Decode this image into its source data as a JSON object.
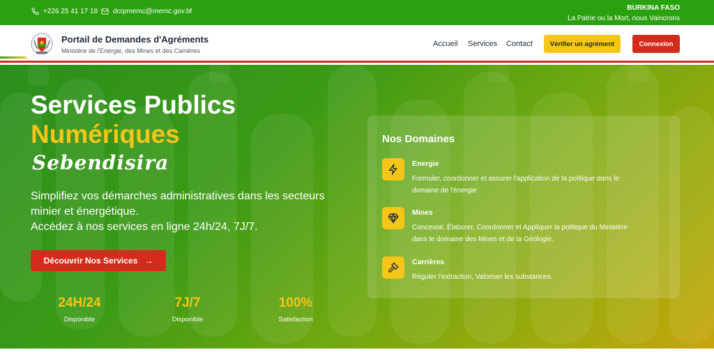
{
  "topbar": {
    "phone": "+226 25 41 17 18",
    "email": "dcrpmemc@memc.gov.bf",
    "country": "BURKINA FASO",
    "motto": "La Patrie ou la Mort, nous Vaincrons"
  },
  "header": {
    "title": "Portail de Demandes d'Agréments",
    "subtitle": "Ministère de l'Energie, des Mines et des Carrières",
    "nav": [
      "Accueil",
      "Services",
      "Contact"
    ],
    "verify_label": "Vérifier un agrément",
    "login_label": "Connexion"
  },
  "hero": {
    "title_line1": "Services Publics",
    "title_line2": "Numériques",
    "script_name": "Sebendisira",
    "desc_line1": "Simplifiez vos démarches administratives dans les secteurs",
    "desc_line2": "minier et énergétique.",
    "desc_line3": "Accédez à nos services en ligne 24h/24, 7J/7.",
    "cta_label": "Découvrir Nos Services",
    "stats": [
      {
        "value": "24H/24",
        "label": "Disponible"
      },
      {
        "value": "7J/7",
        "label": "Disponible"
      },
      {
        "value": "100%",
        "label": "Satisfaction"
      }
    ]
  },
  "domains": {
    "title": "Nos Domaines",
    "items": [
      {
        "title": "Energie",
        "desc_line1": "Formuler, coordonner et assurer l'application de la politique dans le",
        "desc_line2": "domaine de l'énergie",
        "icon": "lightning-icon"
      },
      {
        "title": "Mines",
        "desc_line1": "Concevoir, Élaborer, Coordonner et Appliquer la politique du Ministère",
        "desc_line2": "dans le domaine des Mines et de la Géologie.",
        "icon": "gem-icon"
      },
      {
        "title": "Carrières",
        "desc_line1": "Réguler l'extraction, Valoriser les substances.",
        "icon": "hammer-icon"
      }
    ]
  },
  "colors": {
    "green": "#2aa10f",
    "yellow": "#f5c518",
    "red": "#d42c1c"
  }
}
